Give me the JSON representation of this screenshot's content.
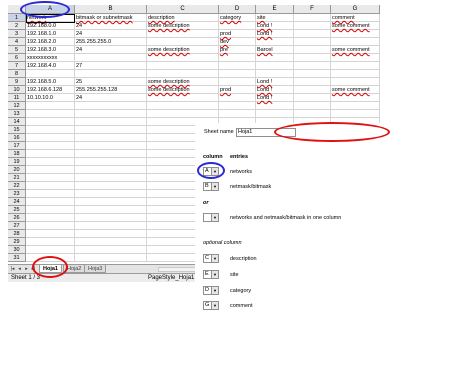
{
  "spreadsheet": {
    "columns": [
      "A",
      "B",
      "C",
      "D",
      "E",
      "F",
      "G"
    ],
    "active_column": "A",
    "row_numbers": [
      "1",
      "2",
      "3",
      "4",
      "5",
      "6",
      "7",
      "8",
      "9",
      "10",
      "11",
      "12",
      "13",
      "14",
      "15",
      "16",
      "17",
      "18",
      "19",
      "20",
      "21",
      "22",
      "23",
      "24",
      "25",
      "26",
      "27",
      "28",
      "29",
      "30",
      "31"
    ],
    "active_row": "1",
    "rows": [
      [
        "network",
        "bitmask or subnetmask",
        "description",
        "category",
        "site",
        "",
        "comment"
      ],
      [
        "192.168.0.0",
        "24",
        "some description",
        "",
        "Lond !",
        "",
        "some comment"
      ],
      [
        "192.168.1.0",
        "24",
        "",
        "prod",
        "Lond !",
        "",
        ""
      ],
      [
        "192.168.2.0",
        "255.255.255.0",
        "",
        "dev",
        "",
        "",
        ""
      ],
      [
        "192.168.3.0",
        "24",
        "some description",
        "pre",
        "Barcel",
        "",
        "some comment"
      ],
      [
        "xxxxxxxxxxx",
        "",
        "",
        "",
        "",
        "",
        ""
      ],
      [
        "192.168.4.0",
        "27",
        "",
        "",
        "",
        "",
        ""
      ],
      [
        "",
        "",
        "",
        "",
        "",
        "",
        ""
      ],
      [
        "192.168.5.0",
        "25",
        "some description",
        "",
        "Lond !",
        "",
        ""
      ],
      [
        "192.168.6.128",
        "255.255.255.128",
        "some description",
        "prod",
        "Lond !",
        "",
        "some comment"
      ],
      [
        "10.10.10.0",
        "24",
        "",
        "",
        "Lond !",
        "",
        ""
      ]
    ]
  },
  "tabs": {
    "items": [
      "Hoja1",
      "Hoja2",
      "Hoja3"
    ],
    "active": "Hoja1"
  },
  "status": {
    "sheet": "Sheet 1 / 3",
    "page_style": "PageStyle_Hoja1",
    "trailing": "D"
  },
  "dialog": {
    "sheet_name_label": "Sheet name",
    "sheet_name_value": "Hoja1",
    "column_header": "column",
    "entries_header": "entries",
    "mappings": [
      {
        "column": "A",
        "label": "networks"
      },
      {
        "column": "B",
        "label": "netmask/bitmask"
      }
    ],
    "or_label": "or",
    "combined": {
      "column": "",
      "label": "networks and netmask/bitmask in one column"
    },
    "optional_header": "optional column",
    "optional": [
      {
        "column": "C",
        "label": "description"
      },
      {
        "column": "E",
        "label": "site"
      },
      {
        "column": "D",
        "label": "category"
      },
      {
        "column": "G",
        "label": "comment"
      }
    ]
  },
  "highlight_colors": {
    "blue_ring": "#2a2ad6",
    "red_ring": "#e01010"
  },
  "icons": {
    "dropdown": "chevron-down-icon",
    "nav": [
      "first-sheet-icon",
      "prev-sheet-icon",
      "next-sheet-icon",
      "last-sheet-icon"
    ]
  }
}
